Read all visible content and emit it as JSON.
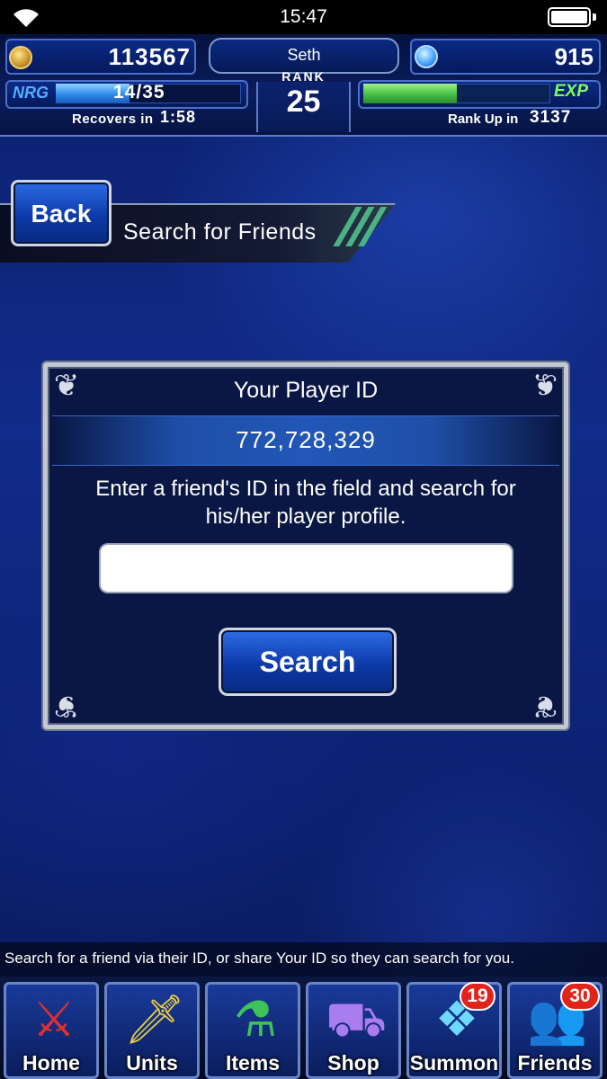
{
  "status_bar": {
    "time": "15:47"
  },
  "hud": {
    "gil": "113567",
    "player_name": "Seth",
    "lapis": "915",
    "nrg_label": "NRG",
    "nrg_text": "14/35",
    "nrg_fraction": 0.4,
    "recovers_label": "Recovers in",
    "recovers_time": "1:58",
    "rank_label": "RANK",
    "rank": "25",
    "exp_label": "EXP",
    "exp_fraction": 0.5,
    "rank_up_label": "Rank Up in",
    "rank_up_value": "3137"
  },
  "header": {
    "back_label": "Back",
    "title": "Search for Friends"
  },
  "panel": {
    "player_id_title": "Your Player ID",
    "player_id": "772,728,329",
    "instructions": "Enter a friend's ID in the field and search for his/her player profile.",
    "input_value": "",
    "search_label": "Search"
  },
  "hint": "Search for a friend via their ID, or share Your ID so they can search for you.",
  "nav": {
    "home": {
      "label": "Home",
      "icon": "crossed-swords-icon"
    },
    "units": {
      "label": "Units",
      "icon": "warrior-icon"
    },
    "items": {
      "label": "Items",
      "icon": "potion-icon"
    },
    "shop": {
      "label": "Shop",
      "icon": "shop-cart-icon"
    },
    "summon": {
      "label": "Summon",
      "icon": "crystal-icon",
      "badge": "19"
    },
    "friends": {
      "label": "Friends",
      "icon": "friends-icon",
      "badge": "30"
    }
  },
  "colors": {
    "accent_blue": "#2e8be8",
    "exp_green": "#46c046",
    "badge_red": "#e1231b"
  }
}
